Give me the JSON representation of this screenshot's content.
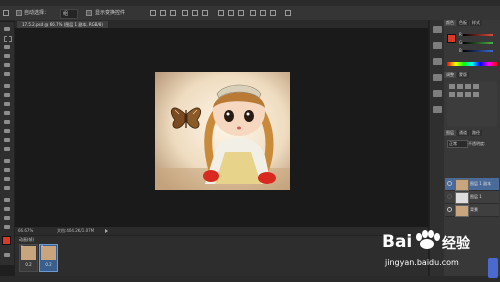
{
  "options_bar": {
    "auto_select_label": "自动选择：",
    "auto_select_value": "组",
    "transform_label": "显示变换控件"
  },
  "document": {
    "tab_title": "17.5.2.psd @ 66.7% (图层 1 副本, RGB/8)"
  },
  "status": {
    "zoom": "66.67%",
    "doc_info": "文档:404.2K/1.07M"
  },
  "animation": {
    "title": "动画(帧)",
    "frames": [
      {
        "num": "1",
        "delay": "0.2"
      },
      {
        "num": "2",
        "delay": "0.2"
      }
    ]
  },
  "panels": {
    "color_tabs": [
      "颜色",
      "色板",
      "样式"
    ],
    "sliders": [
      {
        "label": "R",
        "color": "#e04a3a"
      },
      {
        "label": "G",
        "color": "#4ab04a"
      },
      {
        "label": "B",
        "color": "#3a6ae0"
      }
    ],
    "adjust_tabs": [
      "调整",
      "蒙版"
    ],
    "layers_tabs": [
      "图层",
      "通道",
      "路径"
    ],
    "blend_mode": "正常",
    "opacity_label": "不透明度:",
    "layers": [
      {
        "name": "图层 1 副本",
        "selected": true
      },
      {
        "name": "图层 1",
        "selected": false
      },
      {
        "name": "背景",
        "selected": false
      }
    ]
  },
  "watermark": {
    "brand": "Bai",
    "brand2": "经验",
    "url": "jingyan.baidu.com"
  },
  "colors": {
    "accent": "#3a5f8f",
    "foreground": "#d83a2a",
    "background": "#ffffff"
  }
}
